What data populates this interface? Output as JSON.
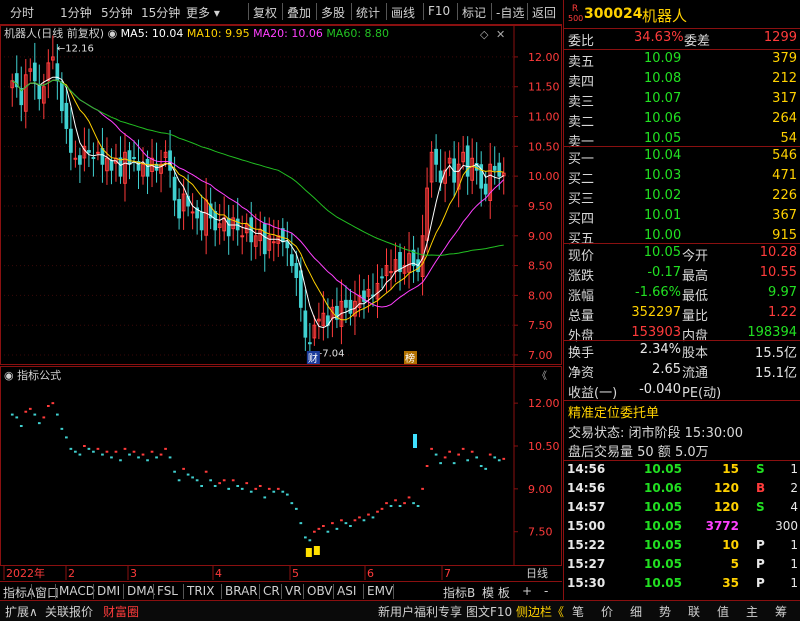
{
  "toolbar": {
    "left": [
      "分时",
      "1分钟",
      "5分钟",
      "15分钟",
      "更多"
    ],
    "right": [
      "复权",
      "叠加",
      "多股",
      "统计",
      "画线",
      "F10",
      "标记",
      "-自选",
      "返回"
    ]
  },
  "chart": {
    "legend_title": "机器人(日线 前复权)",
    "ma": [
      {
        "label": "MA5: 10.04",
        "color": "#ffffff"
      },
      {
        "label": "MA10: 9.95",
        "color": "#ffd100"
      },
      {
        "label": "MA20: 10.06",
        "color": "#ff40ff"
      },
      {
        "label": "MA60: 8.80",
        "color": "#22c022"
      }
    ],
    "high_marker": "12.16",
    "low_marker": "7.04",
    "tag_cai": "财",
    "tag_bang": "榜",
    "sub_title": "指标公式",
    "x_labels": [
      "2022年",
      "2",
      "3",
      "4",
      "5",
      "6",
      "7"
    ],
    "x_period": "日线"
  },
  "chart_data": {
    "type": "candlestick",
    "y_ticks": [
      "12.00",
      "11.50",
      "11.00",
      "10.50",
      "10.00",
      "9.50",
      "9.00",
      "8.50",
      "8.00",
      "7.50",
      "7.00"
    ],
    "sub_y_ticks": [
      "12.00",
      "10.50",
      "9.00",
      "7.50"
    ],
    "ylim": [
      7.0,
      12.2
    ],
    "closes": [
      11.6,
      11.5,
      11.2,
      11.7,
      11.8,
      11.6,
      11.3,
      11.5,
      11.9,
      12.0,
      11.6,
      11.1,
      10.8,
      10.4,
      10.3,
      10.2,
      10.5,
      10.4,
      10.3,
      10.4,
      10.2,
      10.3,
      10.1,
      10.3,
      10.0,
      10.4,
      10.2,
      10.3,
      10.1,
      10.2,
      10.0,
      10.3,
      10.1,
      10.2,
      10.4,
      10.1,
      9.6,
      9.3,
      9.7,
      9.5,
      9.4,
      9.3,
      9.1,
      9.6,
      9.3,
      9.1,
      9.2,
      9.3,
      9.0,
      9.3,
      9.1,
      9.0,
      9.2,
      8.9,
      9.0,
      9.1,
      8.7,
      9.0,
      8.9,
      9.0,
      8.9,
      8.8,
      8.5,
      8.3,
      7.8,
      7.3,
      7.2,
      7.5,
      7.6,
      7.7,
      7.5,
      7.8,
      7.6,
      7.9,
      7.8,
      7.7,
      7.9,
      8.0,
      7.9,
      8.1,
      8.0,
      8.2,
      8.3,
      8.5,
      8.4,
      8.6,
      8.4,
      8.5,
      8.7,
      8.5,
      8.4,
      9.0,
      9.8,
      10.4,
      10.2,
      9.9,
      10.1,
      10.3,
      9.9,
      10.2,
      10.4,
      10.0,
      10.3,
      10.1,
      9.8,
      9.7,
      10.2,
      10.1,
      10.0,
      10.05
    ]
  },
  "quote": {
    "code": "300024",
    "name": "机器人",
    "badge_top": "R",
    "badge_bottom": "500",
    "weibi_label": "委比",
    "weibi_value": "34.63%",
    "weicha_label": "委差",
    "weicha_value": "1299",
    "sells": [
      {
        "label": "卖五",
        "price": "10.09",
        "vol": "379"
      },
      {
        "label": "卖四",
        "price": "10.08",
        "vol": "212"
      },
      {
        "label": "卖三",
        "price": "10.07",
        "vol": "317"
      },
      {
        "label": "卖二",
        "price": "10.06",
        "vol": "264"
      },
      {
        "label": "卖一",
        "price": "10.05",
        "vol": "54"
      }
    ],
    "buys": [
      {
        "label": "买一",
        "price": "10.04",
        "vol": "546"
      },
      {
        "label": "买二",
        "price": "10.03",
        "vol": "471"
      },
      {
        "label": "买三",
        "price": "10.02",
        "vol": "226"
      },
      {
        "label": "买四",
        "price": "10.01",
        "vol": "367"
      },
      {
        "label": "买五",
        "price": "10.00",
        "vol": "915"
      }
    ],
    "stats": [
      {
        "l1": "现价",
        "v1": "10.05",
        "c1": "green",
        "l2": "今开",
        "v2": "10.28",
        "c2": "red"
      },
      {
        "l1": "涨跌",
        "v1": "-0.17",
        "c1": "green",
        "l2": "最高",
        "v2": "10.55",
        "c2": "red"
      },
      {
        "l1": "涨幅",
        "v1": "-1.66%",
        "c1": "green",
        "l2": "最低",
        "v2": "9.97",
        "c2": "green"
      },
      {
        "l1": "总量",
        "v1": "352297",
        "c1": "yellow",
        "l2": "量比",
        "v2": "1.22",
        "c2": "red"
      },
      {
        "l1": "外盘",
        "v1": "153903",
        "c1": "red",
        "l2": "内盘",
        "v2": "198394",
        "c2": "green"
      }
    ],
    "stats2": [
      {
        "l1": "换手",
        "v1": "2.34%",
        "l2": "股本",
        "v2": "15.5亿"
      },
      {
        "l1": "净资",
        "v1": "2.65",
        "l2": "流通",
        "v2": "15.1亿"
      },
      {
        "l1": "收益(一)",
        "v1": "-0.040",
        "l2": "PE(动)",
        "v2": ""
      }
    ],
    "precise_title": "精准定位委托单",
    "trade_status": "交易状态: 闭市阶段 15:30:00",
    "after_hours": "盘后交易量 50 额 5.0万",
    "ticks": [
      {
        "time": "14:56",
        "price": "10.05",
        "vol": "15",
        "vc": "yellow",
        "side": "S",
        "sc": "green",
        "n": "1"
      },
      {
        "time": "14:56",
        "price": "10.06",
        "vol": "120",
        "vc": "yellow",
        "side": "B",
        "sc": "red",
        "n": "2"
      },
      {
        "time": "14:57",
        "price": "10.05",
        "vol": "120",
        "vc": "yellow",
        "side": "S",
        "sc": "green",
        "n": "4"
      },
      {
        "time": "15:00",
        "price": "10.05",
        "vol": "3772",
        "vc": "magenta",
        "side": "",
        "sc": "white",
        "n": "300"
      },
      {
        "time": "15:22",
        "price": "10.05",
        "vol": "10",
        "vc": "yellow",
        "side": "P",
        "sc": "white",
        "n": "1"
      },
      {
        "time": "15:27",
        "price": "10.05",
        "vol": "5",
        "vc": "yellow",
        "side": "P",
        "sc": "white",
        "n": "1"
      },
      {
        "time": "15:30",
        "price": "10.05",
        "vol": "35",
        "vc": "yellow",
        "side": "P",
        "sc": "white",
        "n": "1"
      }
    ]
  },
  "bottom_tabs": [
    "指标A",
    "窗口",
    "MACD",
    "DMI",
    "DMA",
    "FSL",
    "TRIX",
    "BRAR",
    "CR",
    "VR",
    "OBV",
    "ASI",
    "EMV"
  ],
  "bottom_tabs_right": [
    "指标B",
    "模 板",
    "+",
    "-"
  ],
  "statusbar": {
    "left": [
      "扩展∧",
      "关联报价",
      "财富圈"
    ],
    "mid": [
      "新用户福利专享",
      "图文F10",
      "侧边栏《"
    ],
    "right": [
      "笔",
      "价",
      "细",
      "势",
      "联",
      "值",
      "主",
      "筹"
    ]
  }
}
